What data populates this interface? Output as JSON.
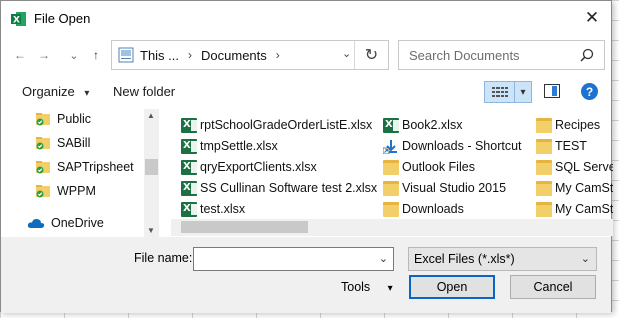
{
  "window": {
    "title": "File Open",
    "close_glyph": "✕"
  },
  "address": {
    "crumbs": [
      "This ...",
      "Documents"
    ],
    "separator": "›",
    "dropdown_glyph": "⌄",
    "refresh_glyph": "↻"
  },
  "search": {
    "placeholder": "Search Documents"
  },
  "nav_buttons": {
    "back": "←",
    "forward": "→",
    "recent": "⌄",
    "up": "↑"
  },
  "toolbar": {
    "organize_label": "Organize",
    "organize_caret": "▾",
    "new_folder_label": "New folder",
    "view_caret": "▾",
    "help_label": "?"
  },
  "sidebar": {
    "items": [
      {
        "label": "Public",
        "icon": "folder-synced-icon"
      },
      {
        "label": "SABill",
        "icon": "folder-synced-icon"
      },
      {
        "label": "SAPTripsheet",
        "icon": "folder-synced-icon"
      },
      {
        "label": "WPPM",
        "icon": "folder-synced-icon"
      },
      {
        "label": "OneDrive",
        "icon": "cloud-icon"
      }
    ],
    "scroll_up": "▲",
    "scroll_down": "▼"
  },
  "files": {
    "col1": [
      {
        "name": "rptSchoolGradeOrderListE.xlsx",
        "type": "excel"
      },
      {
        "name": "tmpSettle.xlsx",
        "type": "excel"
      },
      {
        "name": "qryExportClients.xlsx",
        "type": "excel"
      },
      {
        "name": "SS Cullinan Software test 2.xlsx",
        "type": "excel"
      },
      {
        "name": "test.xlsx",
        "type": "excel"
      }
    ],
    "col2": [
      {
        "name": "Book2.xlsx",
        "type": "excel"
      },
      {
        "name": "Downloads - Shortcut",
        "type": "shortcut"
      },
      {
        "name": "Outlook Files",
        "type": "folder"
      },
      {
        "name": "Visual Studio 2015",
        "type": "folder"
      },
      {
        "name": "Downloads",
        "type": "folder"
      }
    ],
    "col3": [
      {
        "name": "Recipes",
        "type": "folder"
      },
      {
        "name": "TEST",
        "type": "folder"
      },
      {
        "name": "SQL Server",
        "type": "folder"
      },
      {
        "name": "My CamStu",
        "type": "folder"
      },
      {
        "name": "My CamStu",
        "type": "folder"
      }
    ]
  },
  "footer": {
    "file_name_label": "File name:",
    "file_name_value": "",
    "filter_value": "Excel Files (*.xls*)",
    "dropdown_glyph": "⌄",
    "tools_label": "Tools",
    "tools_caret": "▾",
    "open_label": "Open",
    "cancel_label": "Cancel"
  },
  "colors": {
    "excel": "#1d7044",
    "folder": "#f3cf6a",
    "accent": "#0a66c2",
    "sync_check": "#2ea043"
  }
}
